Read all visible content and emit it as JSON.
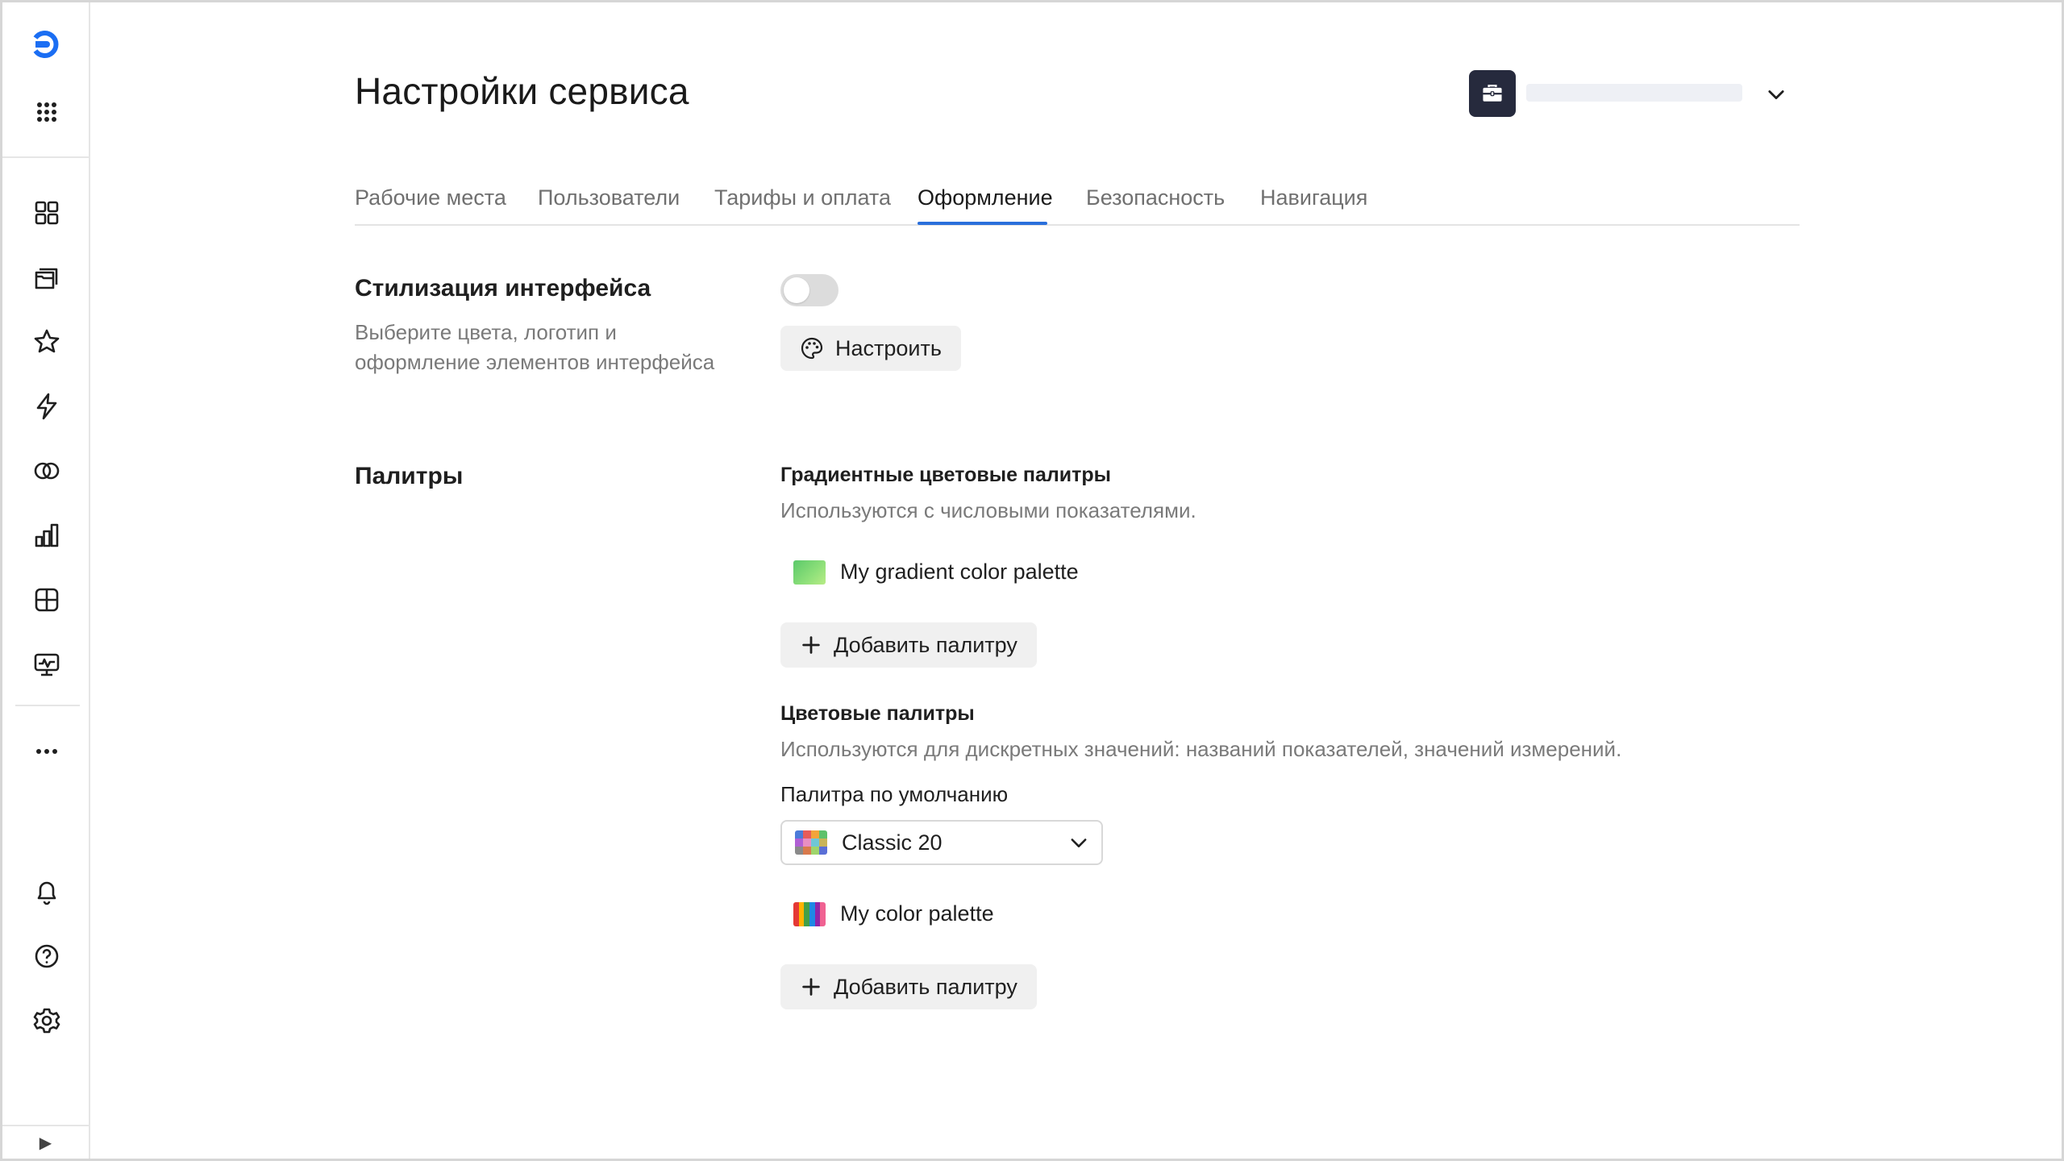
{
  "page": {
    "title": "Настройки сервиса"
  },
  "workspace": {
    "badge_icon": "briefcase-icon"
  },
  "sidebar": {
    "top": [
      "logo-icon",
      "apps-grid-icon"
    ],
    "items": [
      "dashboard-grid-icon",
      "collections-icon",
      "favorites-star-icon",
      "lightning-icon",
      "connections-icon",
      "charts-icon",
      "dataset-icon",
      "monitor-icon",
      "more-icon"
    ],
    "bottom": [
      "notifications-bell-icon",
      "help-icon",
      "settings-gear-icon"
    ],
    "collapse_glyph": "▶"
  },
  "tabs": [
    {
      "label": "Рабочие места"
    },
    {
      "label": "Пользователи"
    },
    {
      "label": "Тарифы и оплата"
    },
    {
      "label": "Оформление",
      "active": true
    },
    {
      "label": "Безопасность"
    },
    {
      "label": "Навигация"
    }
  ],
  "styling": {
    "title": "Стилизация интерфейса",
    "desc_line1": "Выберите цвета, логотип и",
    "desc_line2": "оформление элементов интерфейса",
    "toggle_on": false,
    "configure_label": "Настроить"
  },
  "palettes": {
    "title": "Палитры",
    "gradient": {
      "title": "Градиентные цветовые палитры",
      "desc": "Используются с числовыми показателями.",
      "item": "My gradient color palette",
      "add_label": "Добавить палитру"
    },
    "color": {
      "title": "Цветовые палитры",
      "desc": "Используются для дискретных значений: названий показателей, значений измерений.",
      "default_label": "Палитра по умолчанию",
      "default_value": "Classic 20",
      "item": "My color palette",
      "add_label": "Добавить палитру"
    }
  },
  "colors": {
    "accent": "#2a6fdb",
    "logo": "#1b6ef3",
    "badge_bg": "#262a3d",
    "classic20": [
      "#4c7bd9",
      "#e85b5b",
      "#f2a43a",
      "#5ec16b",
      "#b05fd4",
      "#e88fc2",
      "#6fc7d6",
      "#c9b458",
      "#8a8a8a",
      "#d97a4c",
      "#9fd46b",
      "#5a6fd6"
    ],
    "my_palette": [
      "#e53935",
      "#ffb300",
      "#43a047",
      "#1e88e5",
      "#8e24aa",
      "#f06292"
    ]
  }
}
